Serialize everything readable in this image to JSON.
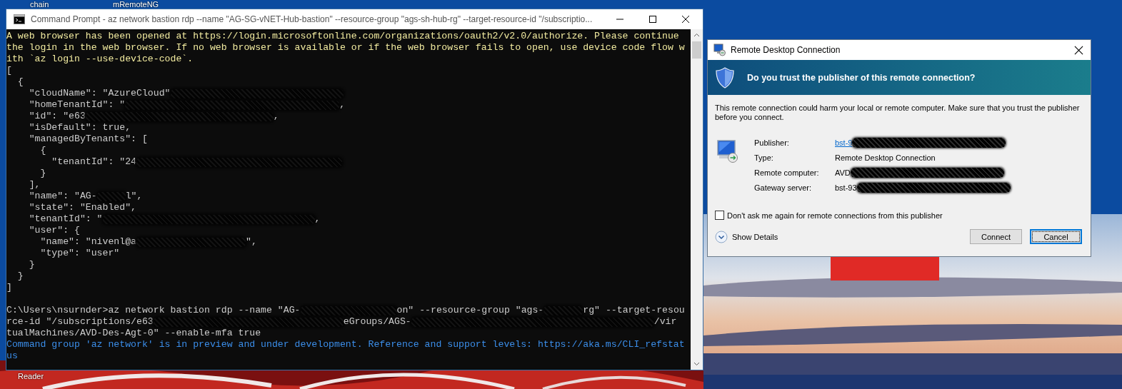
{
  "desktop": {
    "kind": "picture",
    "icons": [
      {
        "label": "chain"
      },
      {
        "label": "mRemoteNG"
      },
      {
        "label": "Reader"
      }
    ]
  },
  "console": {
    "title": "Command Prompt - az  network bastion rdp --name \"AG-SG-vNET-Hub-bastion\" --resource-group \"ags-sh-hub-rg\" --target-resource-id \"/subscriptio...",
    "output": [
      {
        "color": "#f2eba0",
        "parts": [
          {
            "text": "A web browser has been opened at https://login.microsoftonline.com/organizations/oauth2/v2.0/authorize. Please continue"
          }
        ]
      },
      {
        "color": "#f2eba0",
        "parts": [
          {
            "text": "the login in the web browser. If no web browser is available or if the web browser fails to open, use device code flow w"
          }
        ]
      },
      {
        "color": "#f2eba0",
        "parts": [
          {
            "text": "ith `az login --use-device-code`."
          }
        ]
      },
      {
        "color": "#cccccc",
        "parts": [
          {
            "text": "["
          }
        ]
      },
      {
        "color": "#cccccc",
        "parts": [
          {
            "text": "  {"
          }
        ]
      },
      {
        "color": "#cccccc",
        "parts": [
          {
            "text": "    \"cloudName\": \"AzureCloud\""
          },
          {
            "kind": "redaction"
          }
        ]
      },
      {
        "color": "#cccccc",
        "parts": [
          {
            "text": "    \"homeTenantId\": \""
          },
          {
            "kind": "redaction"
          },
          {
            "text": ","
          }
        ]
      },
      {
        "color": "#cccccc",
        "parts": [
          {
            "text": "    \"id\": \"e63"
          },
          {
            "kind": "redaction"
          },
          {
            "text": ","
          }
        ]
      },
      {
        "color": "#cccccc",
        "parts": [
          {
            "text": "    \"isDefault\": true,"
          }
        ]
      },
      {
        "color": "#cccccc",
        "parts": [
          {
            "text": "    \"managedByTenants\": ["
          }
        ]
      },
      {
        "color": "#cccccc",
        "parts": [
          {
            "text": "      {"
          }
        ]
      },
      {
        "color": "#cccccc",
        "parts": [
          {
            "text": "        \"tenantId\": \"24"
          },
          {
            "kind": "redaction"
          }
        ]
      },
      {
        "color": "#cccccc",
        "parts": [
          {
            "text": "      }"
          }
        ]
      },
      {
        "color": "#cccccc",
        "parts": [
          {
            "text": "    ],"
          }
        ]
      },
      {
        "color": "#cccccc",
        "parts": [
          {
            "text": "    \"name\": \"AG-"
          },
          {
            "kind": "redaction"
          },
          {
            "text": "l\","
          }
        ]
      },
      {
        "color": "#cccccc",
        "parts": [
          {
            "text": "    \"state\": \"Enabled\","
          }
        ]
      },
      {
        "color": "#cccccc",
        "parts": [
          {
            "text": "    \"tenantId\": \""
          },
          {
            "kind": "redaction"
          },
          {
            "text": ","
          }
        ]
      },
      {
        "color": "#cccccc",
        "parts": [
          {
            "text": "    \"user\": {"
          }
        ]
      },
      {
        "color": "#cccccc",
        "parts": [
          {
            "text": "      \"name\": \"nivenl@a"
          },
          {
            "kind": "redaction"
          },
          {
            "text": "\","
          }
        ]
      },
      {
        "color": "#cccccc",
        "parts": [
          {
            "text": "      \"type\": \"user\""
          }
        ]
      },
      {
        "color": "#cccccc",
        "parts": [
          {
            "text": "    }"
          }
        ]
      },
      {
        "color": "#cccccc",
        "parts": [
          {
            "text": "  }"
          }
        ]
      },
      {
        "color": "#cccccc",
        "parts": [
          {
            "text": "]"
          }
        ]
      }
    ],
    "command": [
      {
        "color": "#cccccc",
        "parts": [
          {
            "text": "C:\\Users\\nsurnder>az network bastion rdp --name \"AG-"
          },
          {
            "kind": "redaction"
          },
          {
            "text": "on\" --resource-group \"ags-"
          },
          {
            "kind": "redaction"
          },
          {
            "text": "rg\" --target-resou"
          }
        ]
      },
      {
        "color": "#cccccc",
        "parts": [
          {
            "text": "rce-id \"/subscriptions/e63"
          },
          {
            "kind": "redaction"
          },
          {
            "text": "eGroups/AGS-"
          },
          {
            "kind": "redaction"
          },
          {
            "text": "/vir"
          }
        ]
      },
      {
        "color": "#cccccc",
        "parts": [
          {
            "text": "tualMachines/AVD-Des-Agt-0\" --enable-mfa true"
          }
        ]
      },
      {
        "color": "#3b8eea",
        "parts": [
          {
            "text": "Command group 'az network' is in preview and under development. Reference and support levels: https://aka.ms/CLI_refstat"
          }
        ]
      },
      {
        "color": "#3b8eea",
        "parts": [
          {
            "text": "us"
          }
        ]
      }
    ]
  },
  "dialog": {
    "title": "Remote Desktop Connection",
    "heading": "Do you trust the publisher of this remote connection?",
    "warning": "This remote connection could harm your local or remote computer. Make sure that you trust the publisher before you connect.",
    "fields": [
      {
        "kind": "link",
        "label": "Publisher:",
        "value": "bst-9"
      },
      {
        "kind": "text",
        "label": "Type:",
        "value": "Remote Desktop Connection"
      },
      {
        "kind": "text",
        "label": "Remote computer:",
        "value": "AVD"
      },
      {
        "kind": "text",
        "label": "Gateway server:",
        "value": "bst-93"
      }
    ],
    "checkbox": {
      "label": "Don't ask me again for remote connections from this publisher",
      "checked": false
    },
    "details": {
      "label": "Show Details",
      "expanded": false
    },
    "buttons": [
      {
        "label": "Connect",
        "focused": false
      },
      {
        "label": "Cancel",
        "focused": true
      }
    ]
  }
}
